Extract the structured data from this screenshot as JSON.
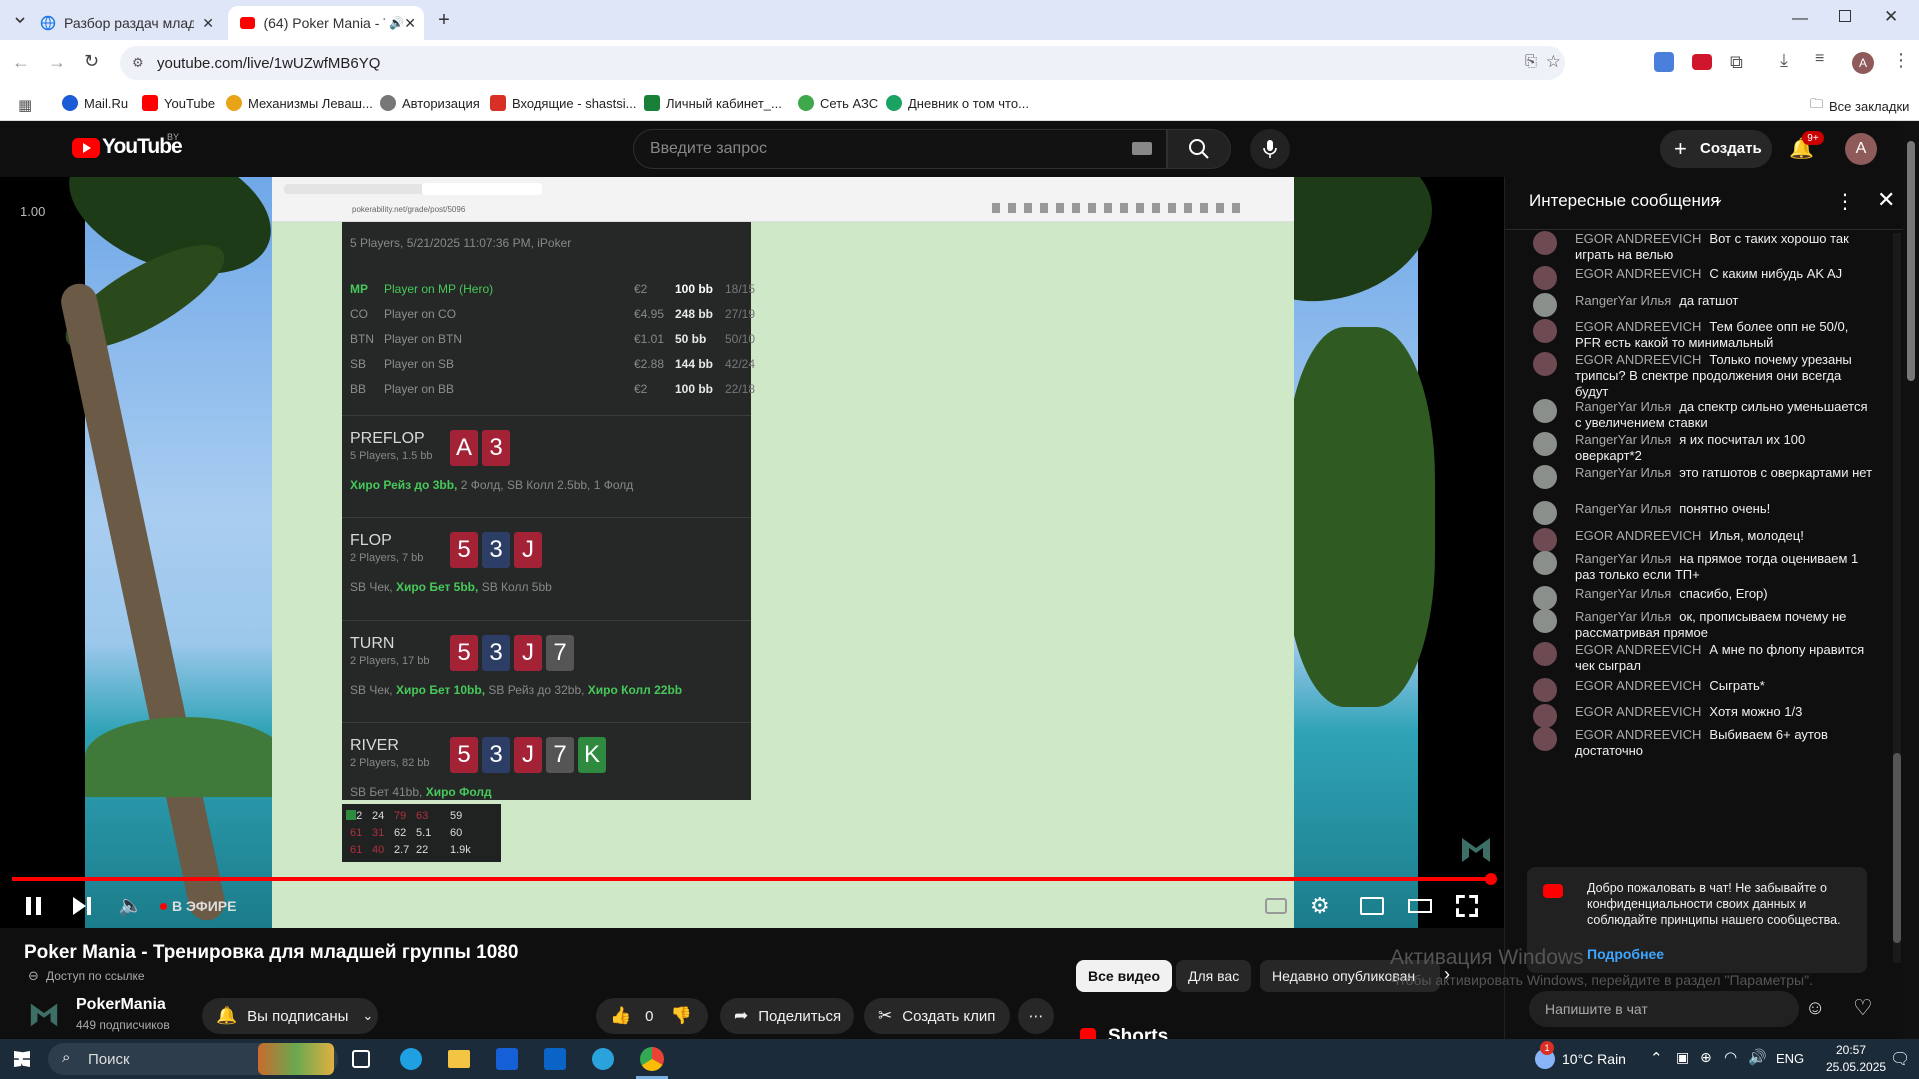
{
  "browser": {
    "tabs": [
      {
        "title": "Разбор раздач младшей групп"
      },
      {
        "title": "(64) Poker Mania - Трениро"
      }
    ],
    "url": "youtube.com/live/1wUZwfMB6YQ",
    "bookmarks": [
      "Mail.Ru",
      "YouTube",
      "Механизмы Леваш...",
      "Авторизация",
      "Входящие - shastsi...",
      "Личный кабинет_...",
      "Сеть АЗС",
      "Дневник о том что..."
    ],
    "all_bookmarks": "Все закладки",
    "profile_letter": "A"
  },
  "youtube": {
    "logo": "YouTube",
    "region": "BY",
    "search_placeholder": "Введите запрос",
    "create_label": "Создать",
    "notif_count": "9+",
    "avatar_letter": "A"
  },
  "video": {
    "speed": "1.00",
    "live_label": "В ЭФИРЕ",
    "inner_url": "pokerability.net/grade/post/5096",
    "hand_header": "5 Players, 5/21/2025 11:07:36 PM, iPoker",
    "players": [
      {
        "pos": "MP",
        "name": "Player on MP (Hero)",
        "money": "€2",
        "bb": "100 bb",
        "stat": "18/15",
        "hero": true
      },
      {
        "pos": "CO",
        "name": "Player on CO",
        "money": "€4.95",
        "bb": "248 bb",
        "stat": "27/19",
        "hero": false
      },
      {
        "pos": "BTN",
        "name": "Player on BTN",
        "money": "€1.01",
        "bb": "50 bb",
        "stat": "50/10",
        "hero": false
      },
      {
        "pos": "SB",
        "name": "Player on SB",
        "money": "€2.88",
        "bb": "144 bb",
        "stat": "42/24",
        "hero": false
      },
      {
        "pos": "BB",
        "name": "Player on BB",
        "money": "€2",
        "bb": "100 bb",
        "stat": "22/18",
        "hero": false
      }
    ],
    "streets": [
      {
        "name": "PREFLOP",
        "sub": "5 Players, 1.5 bb",
        "cards": [
          {
            "r": "A",
            "c": "r"
          },
          {
            "r": "3",
            "c": "r"
          }
        ],
        "hero_action": "Хиро Рейз до 3bb,",
        "rest": "2 Фолд, SB Колл 2.5bb, 1 Фолд",
        "hero2": "",
        "pre": ""
      },
      {
        "name": "FLOP",
        "sub": "2 Players, 7 bb",
        "cards": [
          {
            "r": "5",
            "c": "r"
          },
          {
            "r": "3",
            "c": "b"
          },
          {
            "r": "J",
            "c": "r"
          }
        ],
        "pre": "SB Чек,",
        "hero_action": "Хиро Бет 5bb,",
        "rest": "SB Колл 5bb",
        "hero2": ""
      },
      {
        "name": "TURN",
        "sub": "2 Players, 17 bb",
        "cards": [
          {
            "r": "5",
            "c": "r"
          },
          {
            "r": "3",
            "c": "b"
          },
          {
            "r": "J",
            "c": "r"
          },
          {
            "r": "7",
            "c": "g"
          }
        ],
        "pre": "SB Чек,",
        "hero_action": "Хиро Бет 10bb,",
        "rest": "SB Рейз до 32bb,",
        "hero2": "Хиро Колл 22bb"
      },
      {
        "name": "RIVER",
        "sub": "2 Players, 82 bb",
        "cards": [
          {
            "r": "5",
            "c": "r"
          },
          {
            "r": "3",
            "c": "b"
          },
          {
            "r": "J",
            "c": "r"
          },
          {
            "r": "7",
            "c": "g"
          },
          {
            "r": "K",
            "c": "gr"
          }
        ],
        "pre": "SB Бет 41bb,",
        "hero_action": "Хиро Фолд",
        "rest": "",
        "hero2": ""
      }
    ],
    "stats": [
      [
        "42",
        "24",
        "79",
        "63",
        "59"
      ],
      [
        "61",
        "31",
        "62",
        "5.1",
        "60"
      ],
      [
        "61",
        "40",
        "2.7",
        "22",
        "1.9k"
      ]
    ]
  },
  "chat": {
    "title": "Интересные сообщения",
    "messages": [
      {
        "author": "EGOR ANDREEVICH",
        "text": "Вот с таких хорошо так играть на велью"
      },
      {
        "author": "EGOR ANDREEVICH",
        "text": "С каким нибудь AK AJ"
      },
      {
        "author": "RangerYar Илья",
        "text": "да гатшот"
      },
      {
        "author": "EGOR ANDREEVICH",
        "text": "Тем более опп не 50/0, PFR есть какой то минимальный"
      },
      {
        "author": "EGOR ANDREEVICH",
        "text": "Только почему урезаны трипсы? В спектре продолжения они всегда будут"
      },
      {
        "author": "RangerYar Илья",
        "text": "да спектр сильно уменьшается с увеличением ставки"
      },
      {
        "author": "RangerYar Илья",
        "text": "я их посчитал их 100 оверкарт*2"
      },
      {
        "author": "RangerYar Илья",
        "text": "это гатшотов с оверкартами нет"
      },
      {
        "author": "RangerYar Илья",
        "text": "понятно очень!"
      },
      {
        "author": "EGOR ANDREEVICH",
        "text": "Илья, молодец!"
      },
      {
        "author": "RangerYar Илья",
        "text": "на прямое тогда оцениваем 1 раз только если ТП+"
      },
      {
        "author": "RangerYar Илья",
        "text": "спасибо, Егор)"
      },
      {
        "author": "RangerYar Илья",
        "text": "ок, прописываем почему не рассматривая прямое"
      },
      {
        "author": "EGOR ANDREEVICH",
        "text": "А мне по флопу нравится чек сыграл"
      },
      {
        "author": "EGOR ANDREEVICH",
        "text": "Сыграть*"
      },
      {
        "author": "EGOR ANDREEVICH",
        "text": "Хотя можно 1/3"
      },
      {
        "author": "EGOR ANDREEVICH",
        "text": "Выбиваем 6+ аутов достаточно"
      }
    ],
    "welcome": "Добро пожаловать в чат! Не забывайте о конфиденциальности своих данных и соблюдайте принципы нашего сообщества.",
    "more": "Подробнее",
    "input_placeholder": "Напишите в чат"
  },
  "below": {
    "title": "Poker Mania - Тренировка для младшей группы 1080",
    "access": "Доступ по ссылке",
    "channel": "PokerMania",
    "subs": "449 подписчиков",
    "subscribed": "Вы подписаны",
    "likes": "0",
    "share": "Поделиться",
    "clip": "Создать клип",
    "filters": [
      "Все видео",
      "Для вас",
      "Недавно опубликован"
    ],
    "shorts": "Shorts",
    "watermark1": "Активация Windows",
    "watermark2": "Чтобы активировать Windows, перейдите в раздел \"Параметры\"."
  },
  "taskbar": {
    "search": "Поиск",
    "weather": "10°C Rain",
    "lang": "ENG",
    "time": "20:57",
    "date": "25.05.2025",
    "weather_badge": "1"
  },
  "colors": {
    "yt_red": "#ff0000",
    "bg": "#0f0f0f",
    "hero_green": "#47c85a"
  }
}
